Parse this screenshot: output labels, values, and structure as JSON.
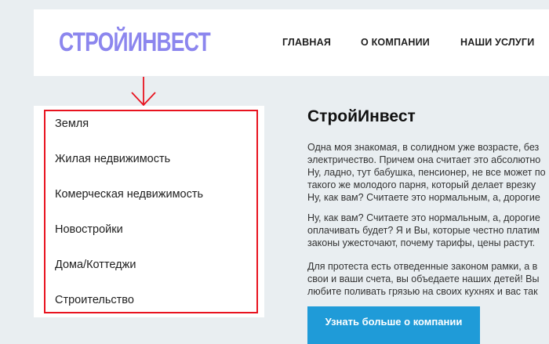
{
  "header": {
    "logo": "СТРОЙИНВЕСТ",
    "nav": [
      "ГЛАВНАЯ",
      "О КОМПАНИИ",
      "НАШИ УСЛУГИ"
    ]
  },
  "sidebar": {
    "items": [
      "Земля",
      "Жилая недвижимость",
      "Комерческая недвижимость",
      "Новостройки",
      "Дома/Коттеджи",
      "Строительство"
    ]
  },
  "annotation": {
    "arrow_icon": "down-arrow-icon",
    "color": "#e8131f"
  },
  "content": {
    "title": "СтройИнвест",
    "paragraphs": [
      [
        "Одна моя знакомая, в солидном уже возрасте, без",
        "электричество. Причем она считает это абсолютно",
        "Ну, ладно, тут бабушка, пенсионер, не все может по",
        "такого же молодого парня, который делает врезку",
        "Ну, как вам? Считаете это нормальным, а, дорогие"
      ],
      [
        "Ну, как вам? Считаете это нормальным, а, дорогие",
        "оплачивать будет? Я и Вы, которые честно платим",
        "законы ужесточают, почему тарифы, цены растут."
      ],
      [
        "Для протеста есть отведенные законом рамки, а в",
        "свои и ваши счета, вы объедаете наших детей! Вы",
        "любите поливать грязью на своих кухнях и вас так"
      ]
    ],
    "cta_label": "Узнать больше о компании"
  },
  "colors": {
    "logo": "#8c86ee",
    "accent": "#1f9bd8",
    "highlight": "#e8131f",
    "background": "#e9eef1"
  }
}
